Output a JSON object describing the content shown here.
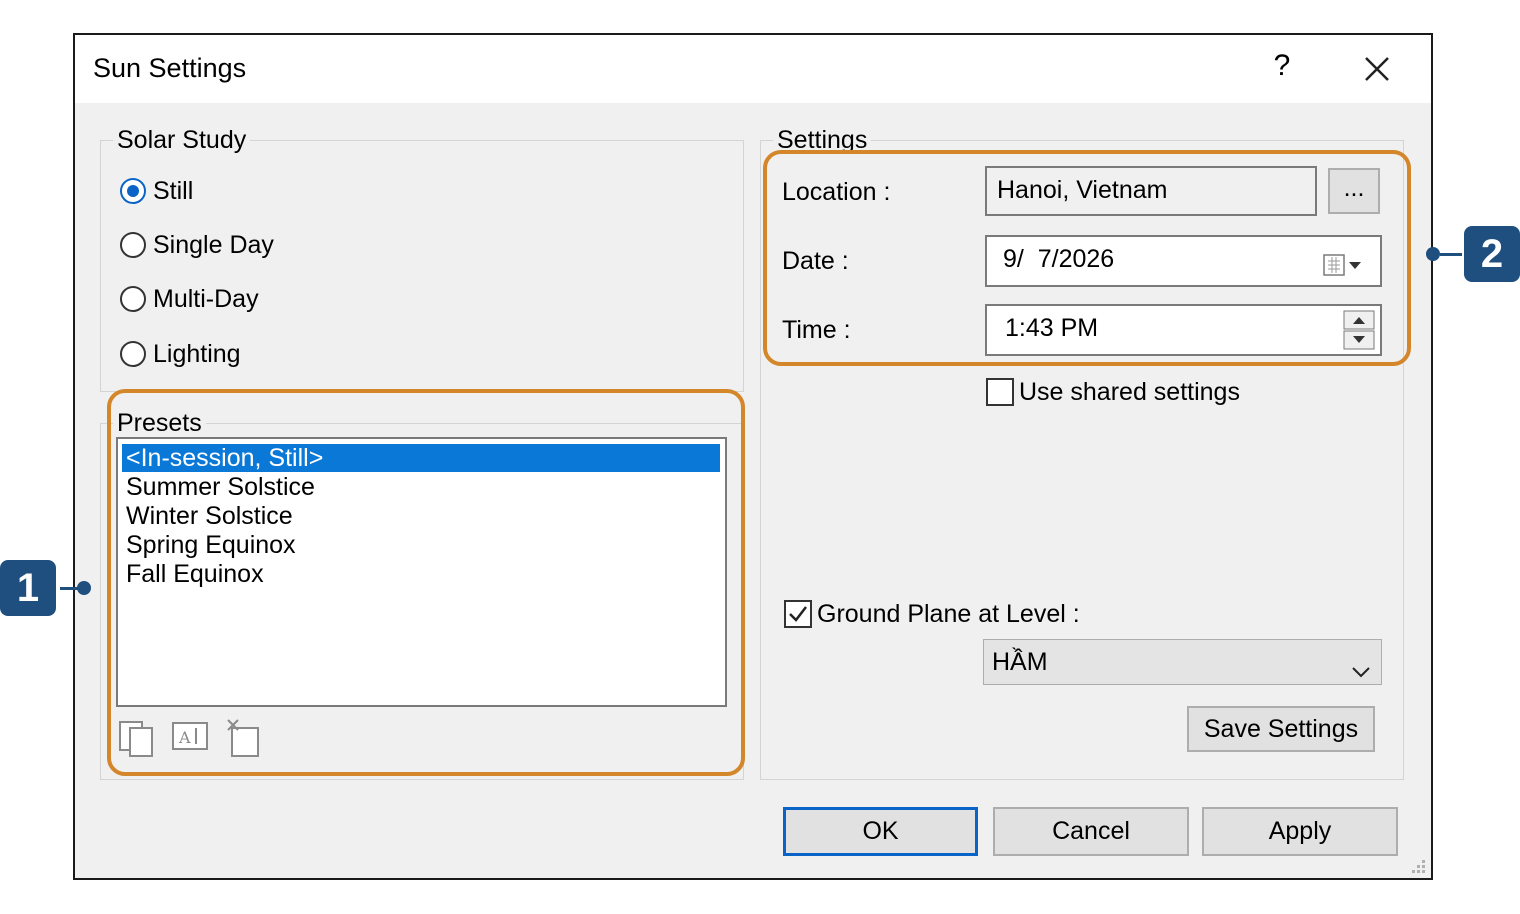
{
  "window": {
    "title": "Sun Settings",
    "help_label": "?"
  },
  "solar_study": {
    "legend": "Solar Study",
    "options": [
      {
        "label": "Still",
        "checked": true
      },
      {
        "label": "Single Day",
        "checked": false
      },
      {
        "label": "Multi-Day",
        "checked": false
      },
      {
        "label": "Lighting",
        "checked": false
      }
    ]
  },
  "presets": {
    "legend": "Presets",
    "items": [
      "<In-session, Still>",
      "Summer Solstice",
      "Winter Solstice",
      "Spring Equinox",
      "Fall Equinox"
    ],
    "selected_index": 0,
    "tool_icons": [
      "duplicate-icon",
      "rename-icon",
      "delete-icon"
    ]
  },
  "settings": {
    "legend": "Settings",
    "location_label": "Location :",
    "location_value": "Hanoi, Vietnam",
    "browse_label": "...",
    "date_label": "Date :",
    "date_value": "9/  7/2026",
    "time_label": "Time :",
    "time_value": "1:43 PM",
    "use_shared_label": "Use shared settings",
    "use_shared_checked": false,
    "ground_plane_label": "Ground Plane at Level :",
    "ground_plane_checked": true,
    "level_value": "HẦM",
    "save_label": "Save Settings"
  },
  "footer": {
    "ok_label": "OK",
    "cancel_label": "Cancel",
    "apply_label": "Apply"
  },
  "callouts": {
    "one": "1",
    "two": "2",
    "color": "#d4862a",
    "badge_color": "#1f4f7f"
  }
}
